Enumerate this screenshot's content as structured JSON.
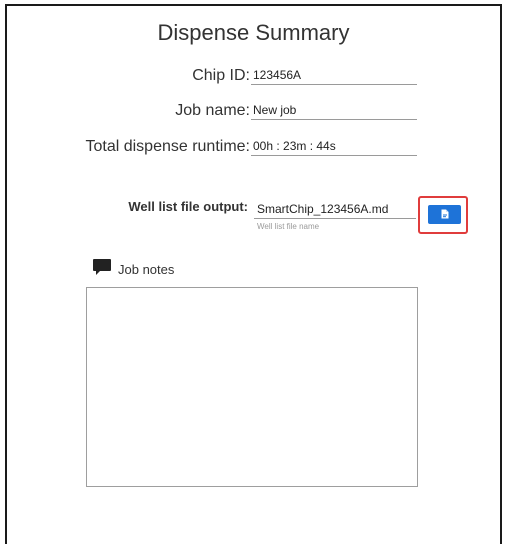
{
  "title": "Dispense Summary",
  "fields": {
    "chip_id": {
      "label": "Chip ID:",
      "value": "123456A"
    },
    "job_name": {
      "label": "Job name:",
      "value": "New job"
    },
    "runtime": {
      "label": "Total dispense runtime:",
      "value": "00h : 23m : 44s"
    }
  },
  "well_list": {
    "label": "Well list file output:",
    "value": "SmartChip_123456A.md",
    "helper": "Well list file name",
    "button_icon": "file-icon",
    "highlight_color": "#e03c3c",
    "button_color": "#1e73d8"
  },
  "notes": {
    "label": "Job notes",
    "icon": "comment-icon",
    "value": ""
  }
}
